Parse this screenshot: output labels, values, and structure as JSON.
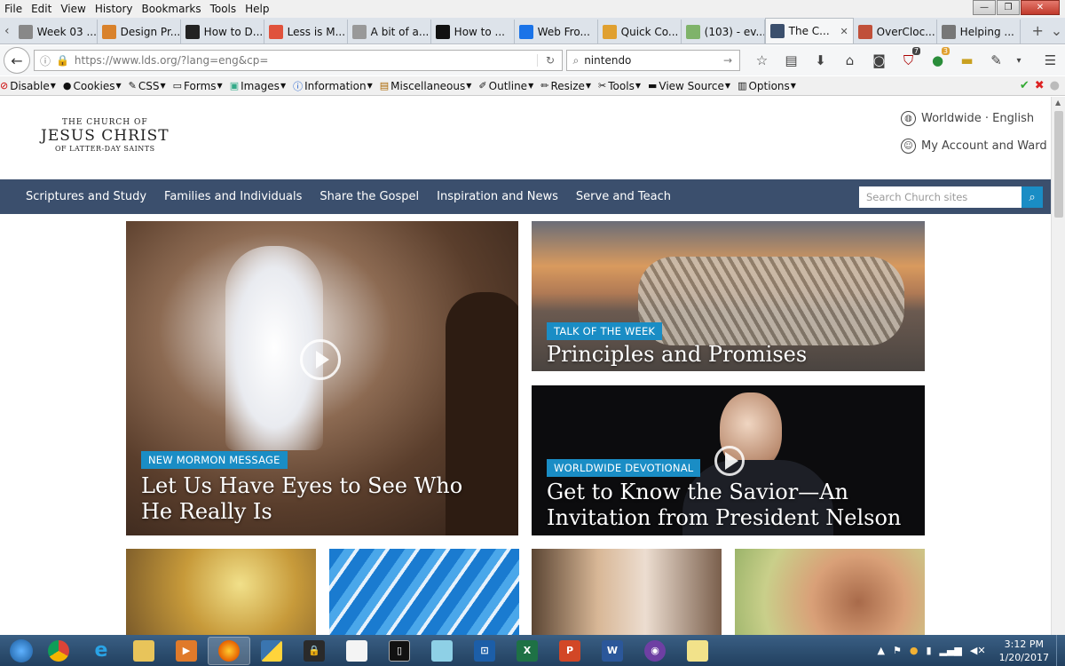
{
  "menubar": {
    "items": [
      "File",
      "Edit",
      "View",
      "History",
      "Bookmarks",
      "Tools",
      "Help"
    ]
  },
  "tabs": [
    {
      "label": "Week 03 ...",
      "color": "#888888"
    },
    {
      "label": "Design Pr...",
      "color": "#d9822b"
    },
    {
      "label": "How to D...",
      "color": "#222222"
    },
    {
      "label": "Less is M...",
      "color": "#e0523c"
    },
    {
      "label": "A bit of a...",
      "color": "#999999"
    },
    {
      "label": "How to ...",
      "color": "#111111"
    },
    {
      "label": "Web Fro...",
      "color": "#1a73e8"
    },
    {
      "label": "Quick Co...",
      "color": "#e0a030"
    },
    {
      "label": "(103) - ev...",
      "color": "#7fb36a"
    },
    {
      "label": "The C...",
      "color": "#3b4f6d",
      "active": true
    },
    {
      "label": "OverCloc...",
      "color": "#c0503a"
    },
    {
      "label": "Helping ...",
      "color": "#777777"
    }
  ],
  "urlbar": {
    "url": "https://www.lds.org/?lang=eng&cp="
  },
  "searchbar": {
    "value": "nintendo"
  },
  "navicons": [
    "star-icon",
    "reading-list-icon",
    "download-icon",
    "home-icon",
    "pocket-icon",
    "shield-icon",
    "ghostery-icon",
    "ruler-icon",
    "eyedropper-icon"
  ],
  "navbadges": [
    "7",
    "3"
  ],
  "devbar": {
    "items": [
      "Disable",
      "Cookies",
      "CSS",
      "Forms",
      "Images",
      "Information",
      "Miscellaneous",
      "Outline",
      "Resize",
      "Tools",
      "View Source",
      "Options"
    ]
  },
  "site": {
    "logo": {
      "line1": "THE CHURCH OF",
      "line2": "JESUS CHRIST",
      "line3": "OF LATTER-DAY SAINTS"
    },
    "toplinks": {
      "language": "Worldwide · English",
      "account": "My Account and Ward"
    },
    "nav": [
      "Scriptures and Study",
      "Families and Individuals",
      "Share the Gospel",
      "Inspiration and News",
      "Serve and Teach"
    ],
    "search_placeholder": "Search Church sites"
  },
  "cards": {
    "main": {
      "tag": "NEW MORMON MESSAGE",
      "title": "Let Us Have Eyes to See Who He Really Is"
    },
    "talk": {
      "tag": "TALK OF THE WEEK",
      "title": "Principles and Promises"
    },
    "devotional": {
      "tag": "WORLDWIDE DEVOTIONAL",
      "title": "Get to Know the Savior—An Invitation from President Nelson"
    }
  },
  "taskbar": {
    "apps": [
      "chrome",
      "internet-explorer",
      "file-explorer",
      "media-player",
      "firefox",
      "python",
      "security",
      "notepad",
      "terminal",
      "sticky",
      "sourcetree",
      "excel",
      "powerpoint",
      "word",
      "github",
      "notes"
    ],
    "time": "3:12 PM",
    "date": "1/20/2017"
  }
}
